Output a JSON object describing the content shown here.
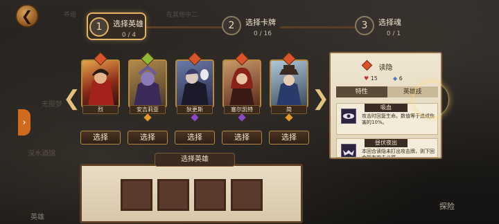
{
  "background": {
    "labels": [
      "养组",
      "在其他中二",
      "无限梦",
      "深水酒馆",
      "深水",
      "英雄"
    ],
    "bottom_right": "探险"
  },
  "steps": [
    {
      "num": "1",
      "title": "选择英雄",
      "count": "0 / 4"
    },
    {
      "num": "2",
      "title": "选择卡牌",
      "count": "0 / 16"
    },
    {
      "num": "3",
      "title": "选择魂",
      "count": "0 / 1"
    }
  ],
  "heroes": [
    {
      "name": "烈",
      "select": "选择"
    },
    {
      "name": "安吉莉亚",
      "select": "选择"
    },
    {
      "name": "狄更斯",
      "select": "选择"
    },
    {
      "name": "塞尔凯特",
      "select": "选择"
    },
    {
      "name": "简",
      "select": "选择"
    }
  ],
  "selection_panel": {
    "title": "选择英雄",
    "slots": 4
  },
  "detail": {
    "hero_name": "读隐",
    "stat_hp": "15",
    "stat_other": "6",
    "tabs": [
      "特性",
      "英雄技"
    ],
    "skills": [
      {
        "name": "吸血",
        "desc": "攻击时回复生命。数值等于造成伤害的10%。"
      },
      {
        "name": "昼伏夜出",
        "desc": "本回合读隐未打出攻击牌，则下回合所有攻击必然"
      }
    ]
  },
  "colors": {
    "accent_gold": "#e5b565",
    "panel_parchment": "#e8dcc3",
    "button_dark": "#3b2a1c"
  },
  "icons": [
    "back-arrow-icon",
    "chevron-right-icon",
    "chevron-left-icon",
    "heart-icon",
    "fire-element-icon"
  ]
}
